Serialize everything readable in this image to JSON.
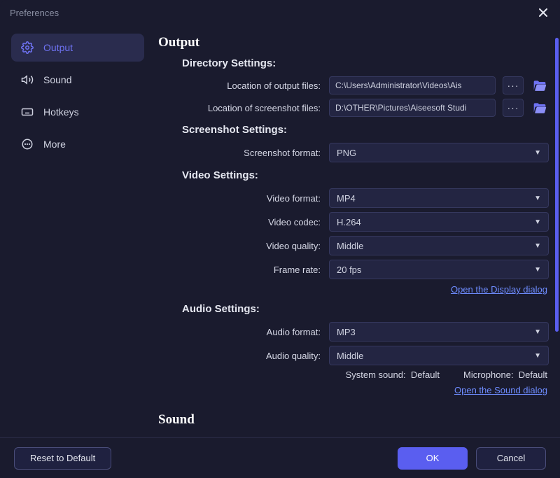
{
  "title": "Preferences",
  "sidebar": {
    "items": [
      {
        "label": "Output",
        "icon": "gear-icon",
        "active": true
      },
      {
        "label": "Sound",
        "icon": "speaker-icon",
        "active": false
      },
      {
        "label": "Hotkeys",
        "icon": "keyboard-icon",
        "active": false
      },
      {
        "label": "More",
        "icon": "more-icon",
        "active": false
      }
    ]
  },
  "output": {
    "heading": "Output",
    "directory": {
      "heading": "Directory Settings:",
      "output_files_label": "Location of output files:",
      "output_files_path": "C:\\Users\\Administrator\\Videos\\Ais",
      "screenshot_files_label": "Location of screenshot files:",
      "screenshot_files_path": "D:\\OTHER\\Pictures\\Aiseesoft Studi"
    },
    "screenshot": {
      "heading": "Screenshot Settings:",
      "format_label": "Screenshot format:",
      "format_value": "PNG"
    },
    "video": {
      "heading": "Video Settings:",
      "format_label": "Video format:",
      "format_value": "MP4",
      "codec_label": "Video codec:",
      "codec_value": "H.264",
      "quality_label": "Video quality:",
      "quality_value": "Middle",
      "frame_rate_label": "Frame rate:",
      "frame_rate_value": "20 fps",
      "display_link": "Open the Display dialog"
    },
    "audio": {
      "heading": "Audio Settings:",
      "format_label": "Audio format:",
      "format_value": "MP3",
      "quality_label": "Audio quality:",
      "quality_value": "Middle",
      "system_sound_label": "System sound:",
      "system_sound_value": "Default",
      "microphone_label": "Microphone:",
      "microphone_value": "Default",
      "sound_link": "Open the Sound dialog"
    }
  },
  "sound_section": {
    "heading": "Sound"
  },
  "footer": {
    "reset": "Reset to Default",
    "ok": "OK",
    "cancel": "Cancel"
  },
  "more_glyph": "···"
}
